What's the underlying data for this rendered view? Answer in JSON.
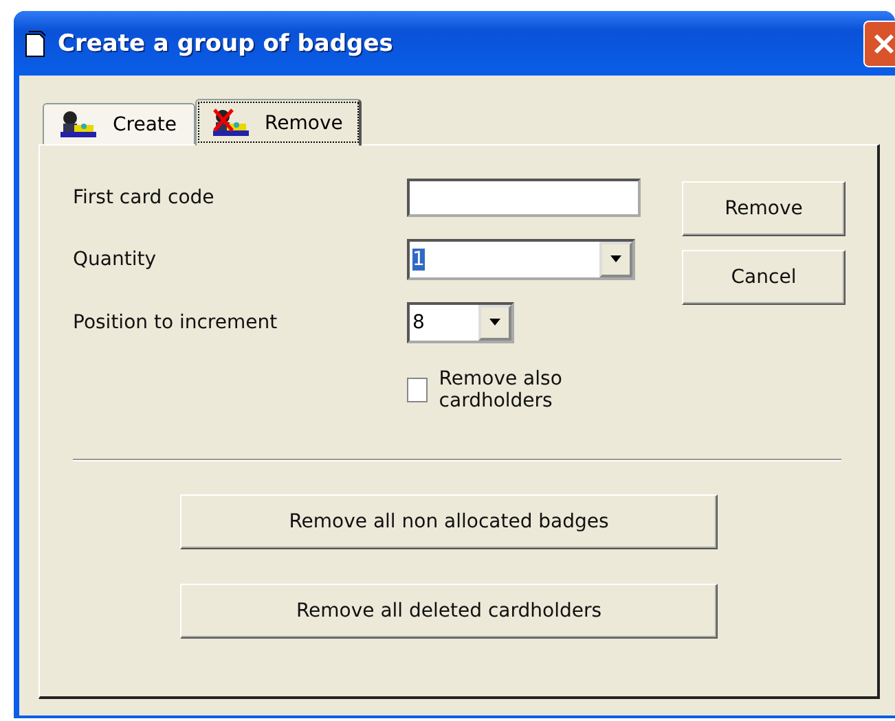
{
  "window": {
    "title": "Create a group of badges"
  },
  "tabs": [
    {
      "label": "Create",
      "selected": false,
      "kind": "create"
    },
    {
      "label": "Remove",
      "selected": true,
      "kind": "remove"
    }
  ],
  "form": {
    "first_card_code": {
      "label": "First card code"
    },
    "quantity": {
      "label": "Quantity",
      "value": "1"
    },
    "position_to_increment": {
      "label": "Position to increment",
      "value": "8"
    },
    "remove_also_cardholders": {
      "label": "Remove also cardholders",
      "checked": false
    }
  },
  "side_buttons": [
    "Remove",
    "Cancel"
  ],
  "bottom_buttons": [
    "Remove all non allocated badges",
    "Remove all deleted cardholders"
  ]
}
